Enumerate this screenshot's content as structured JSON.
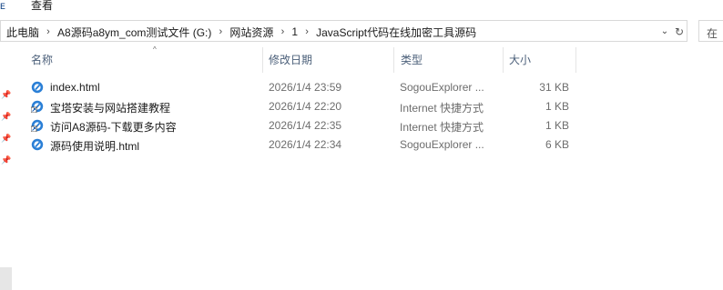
{
  "ribbon": {
    "view_tab": "查看"
  },
  "address": {
    "crumbs": [
      "此电脑",
      "A8源码a8ym_com测试文件 (G:)",
      "网站资源",
      "1",
      "JavaScript代码在线加密工具源码"
    ],
    "search_label": "在"
  },
  "columns": {
    "name": "名称",
    "date": "修改日期",
    "type": "类型",
    "size": "大小"
  },
  "files": [
    {
      "name": "index.html",
      "date": "2026/1/4 23:59",
      "type": "SogouExplorer ...",
      "size": "31 KB",
      "icon": "sogou-html-icon"
    },
    {
      "name": "宝塔安装与网站搭建教程",
      "date": "2026/1/4 22:20",
      "type": "Internet 快捷方式",
      "size": "1 KB",
      "icon": "internet-shortcut-icon"
    },
    {
      "name": "访问A8源码-下载更多内容",
      "date": "2026/1/4 22:35",
      "type": "Internet 快捷方式",
      "size": "1 KB",
      "icon": "internet-shortcut-icon"
    },
    {
      "name": "源码使用说明.html",
      "date": "2026/1/4 22:34",
      "type": "SogouExplorer ...",
      "size": "6 KB",
      "icon": "sogou-html-icon"
    }
  ],
  "colors": {
    "header_text": "#4c607a",
    "detail_text": "#6d6d6d",
    "icon_blue": "#2a7fd6"
  }
}
